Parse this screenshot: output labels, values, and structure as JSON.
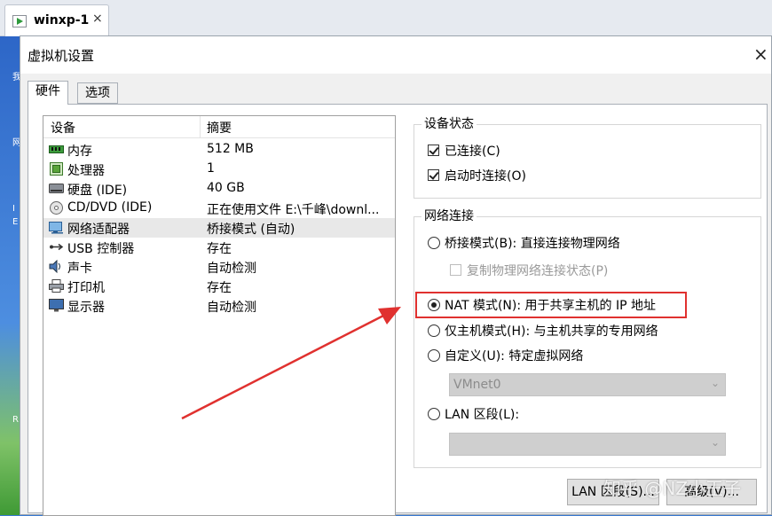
{
  "vm_tab": {
    "label": "winxp-1",
    "close": "×"
  },
  "dialog": {
    "title": "虚拟机设置",
    "close": "×",
    "tabs": [
      {
        "label": "硬件",
        "active": true
      },
      {
        "label": "选项",
        "active": false
      }
    ]
  },
  "device_table": {
    "headers": {
      "device": "设备",
      "summary": "摘要"
    },
    "rows": [
      {
        "icon": "memory-icon",
        "name": "内存",
        "summary": "512 MB"
      },
      {
        "icon": "processor-icon",
        "name": "处理器",
        "summary": "1"
      },
      {
        "icon": "hard-disk-icon",
        "name": "硬盘 (IDE)",
        "summary": "40 GB"
      },
      {
        "icon": "cd-dvd-icon",
        "name": "CD/DVD (IDE)",
        "summary": "正在使用文件 E:\\千峰\\downl..."
      },
      {
        "icon": "network-adapter-icon",
        "name": "网络适配器",
        "summary": "桥接模式 (自动)",
        "selected": true
      },
      {
        "icon": "usb-icon",
        "name": "USB 控制器",
        "summary": "存在"
      },
      {
        "icon": "sound-card-icon",
        "name": "声卡",
        "summary": "自动检测"
      },
      {
        "icon": "printer-icon",
        "name": "打印机",
        "summary": "存在"
      },
      {
        "icon": "display-icon",
        "name": "显示器",
        "summary": "自动检测"
      }
    ]
  },
  "device_status": {
    "title": "设备状态",
    "connected": {
      "label": "已连接(C)",
      "checked": true
    },
    "connect_at_power_on": {
      "label": "启动时连接(O)",
      "checked": true
    }
  },
  "network_connection": {
    "title": "网络连接",
    "bridged": {
      "label": "桥接模式(B): 直接连接物理网络",
      "selected": false
    },
    "replicate_state": {
      "label": "复制物理网络连接状态(P)",
      "checked": false,
      "enabled": false
    },
    "nat": {
      "label": "NAT 模式(N): 用于共享主机的 IP 地址",
      "selected": true
    },
    "host_only": {
      "label": "仅主机模式(H): 与主机共享的专用网络",
      "selected": false
    },
    "custom": {
      "label": "自定义(U): 特定虚拟网络",
      "selected": false
    },
    "custom_select": {
      "value": "VMnet0",
      "enabled": false
    },
    "lan_segment": {
      "label": "LAN 区段(L):",
      "selected": false
    },
    "lan_select": {
      "value": "",
      "enabled": false
    }
  },
  "buttons": {
    "lan_segments": "LAN 区段(S)...",
    "advanced": "高级(V)..."
  },
  "watermark": "知乎 @NZ小王子",
  "colors": {
    "annotation_red": "#e0312f",
    "selected_row": "#e8e8e8"
  }
}
